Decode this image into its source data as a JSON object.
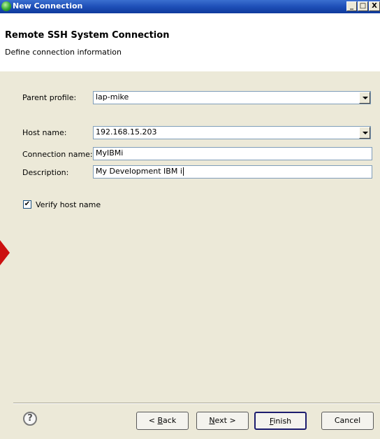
{
  "window": {
    "title": "New Connection",
    "controls": {
      "minimize": "_",
      "maximize": "□",
      "close": "X"
    }
  },
  "header": {
    "title": "Remote SSH System Connection",
    "subtitle": "Define connection information"
  },
  "form": {
    "parent_profile": {
      "label": "Parent profile:",
      "value": "lap-mike"
    },
    "host_name": {
      "label": "Host name:",
      "value": "192.168.15.203"
    },
    "connection_name": {
      "label": "Connection name:",
      "value": "MyIBMi"
    },
    "description": {
      "label": "Description:",
      "value": "My Development IBM i"
    },
    "verify_host": {
      "label": "Verify host name",
      "checked": true,
      "mark": "✔"
    }
  },
  "buttons": {
    "help": "?",
    "back": {
      "pre": "< ",
      "mnemonic": "B",
      "post": "ack"
    },
    "next": {
      "mnemonic": "N",
      "post": "ext >"
    },
    "finish": {
      "mnemonic": "F",
      "post": "inish"
    },
    "cancel": "Cancel"
  },
  "colors": {
    "titlebar": "#1e4fb8",
    "dialog_bg": "#ece9d8",
    "annotation_arrow": "#cc1010"
  }
}
